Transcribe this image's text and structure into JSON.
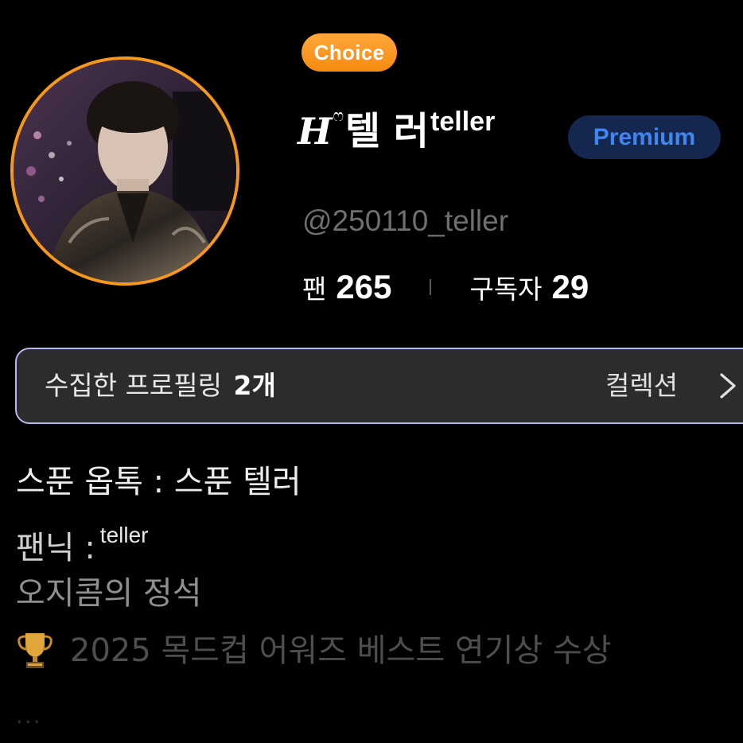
{
  "profile": {
    "choice_badge": "Choice",
    "name_logo": "H",
    "name_heart": "ෆ",
    "name_main": "텔 러",
    "name_sup": "teller",
    "premium_badge": "Premium",
    "handle": "@250110_teller",
    "stats": {
      "fans_label": "팬",
      "fans_value": "265",
      "subscribers_label": "구독자",
      "subscribers_value": "29"
    }
  },
  "collection": {
    "label": "수집한 프로필링",
    "count": "2개",
    "link_label": "컬렉션"
  },
  "bio": {
    "line1": "스푼 옵톡 : 스푼 텔러",
    "line2": "팬닉 :",
    "line2_sup": "teller",
    "line3": "오지콤의 정석",
    "line4": "2025 목드컵 어워즈 베스트 연기상 수상",
    "more": "..."
  },
  "colors": {
    "background": "#000000",
    "choice_orange": "#f5981d",
    "premium_bg": "#15274f",
    "premium_text": "#3f86f0",
    "card_border": "#b9b7f2",
    "card_bg": "#2c2c2e"
  },
  "icons": {
    "trophy": "trophy-icon",
    "chevron": "chevron-right-icon"
  }
}
